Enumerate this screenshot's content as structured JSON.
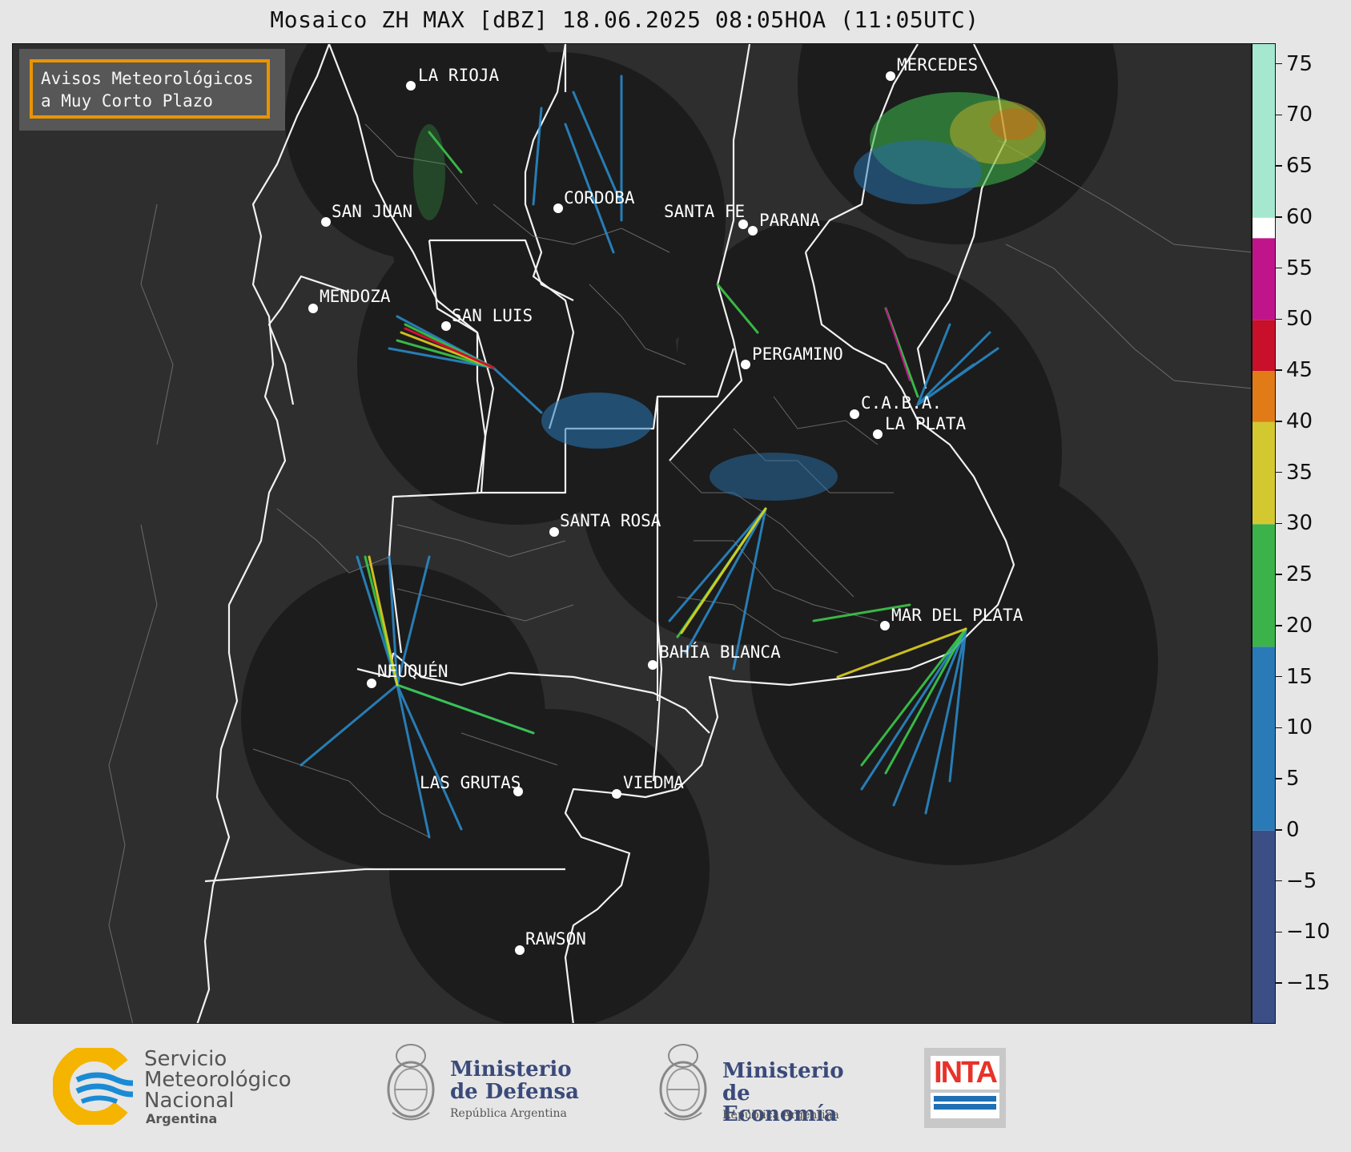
{
  "title": "Mosaico ZH MAX [dBZ] 18.06.2025 08:05HOA (11:05UTC)",
  "warning_box": {
    "line1": "Avisos Meteorológicos",
    "line2": "a Muy Corto Plazo",
    "border_color": "#f59a00"
  },
  "cities": [
    {
      "name": "LA RIOJA"
    },
    {
      "name": "CORDOBA"
    },
    {
      "name": "SAN JUAN"
    },
    {
      "name": "SANTA FE"
    },
    {
      "name": "PARANA"
    },
    {
      "name": "MENDOZA"
    },
    {
      "name": "SAN LUIS"
    },
    {
      "name": "PERGAMINO"
    },
    {
      "name": "C.A.B.A."
    },
    {
      "name": "LA PLATA"
    },
    {
      "name": "SANTA ROSA"
    },
    {
      "name": "MERCEDES"
    },
    {
      "name": "MAR DEL PLATA"
    },
    {
      "name": "BAHÍA BLANCA"
    },
    {
      "name": "NEUQUÉN"
    },
    {
      "name": "LAS GRUTAS"
    },
    {
      "name": "VIEDMA"
    },
    {
      "name": "RAWSON"
    }
  ],
  "colorbar": {
    "unit": "dBZ",
    "range": [
      -19,
      77
    ],
    "tick_labels": [
      "75",
      "70",
      "65",
      "60",
      "55",
      "50",
      "45",
      "40",
      "35",
      "30",
      "25",
      "20",
      "15",
      "10",
      "5",
      "0",
      "−5",
      "−10",
      "−15"
    ],
    "tick_values": [
      75,
      70,
      65,
      60,
      55,
      50,
      45,
      40,
      35,
      30,
      25,
      20,
      15,
      10,
      5,
      0,
      -5,
      -10,
      -15
    ],
    "segments": [
      {
        "from": -19,
        "to": 0,
        "color": "#3b4f86"
      },
      {
        "from": 0,
        "to": 18,
        "color": "#2a7ab8"
      },
      {
        "from": 18,
        "to": 30,
        "color": "#3cb24a"
      },
      {
        "from": 30,
        "to": 40,
        "color": "#d4c830"
      },
      {
        "from": 40,
        "to": 45,
        "color": "#e07b18"
      },
      {
        "from": 45,
        "to": 50,
        "color": "#c8102a"
      },
      {
        "from": 50,
        "to": 58,
        "color": "#c0158a"
      },
      {
        "from": 58,
        "to": 60,
        "color": "#ffffff"
      },
      {
        "from": 60,
        "to": 77,
        "color": "#a5e8cf"
      }
    ]
  },
  "logos": {
    "smn_line1": "Servicio",
    "smn_line2": "Meteorológico",
    "smn_line3": "Nacional",
    "smn_line4": "Argentina",
    "defensa_line1": "Ministerio",
    "defensa_line2": "de Defensa",
    "defensa_line3": "República Argentina",
    "economia_line1": "Ministerio",
    "economia_line2": "de Economía",
    "economia_line3": "República Argentina",
    "inta": "INTA"
  }
}
